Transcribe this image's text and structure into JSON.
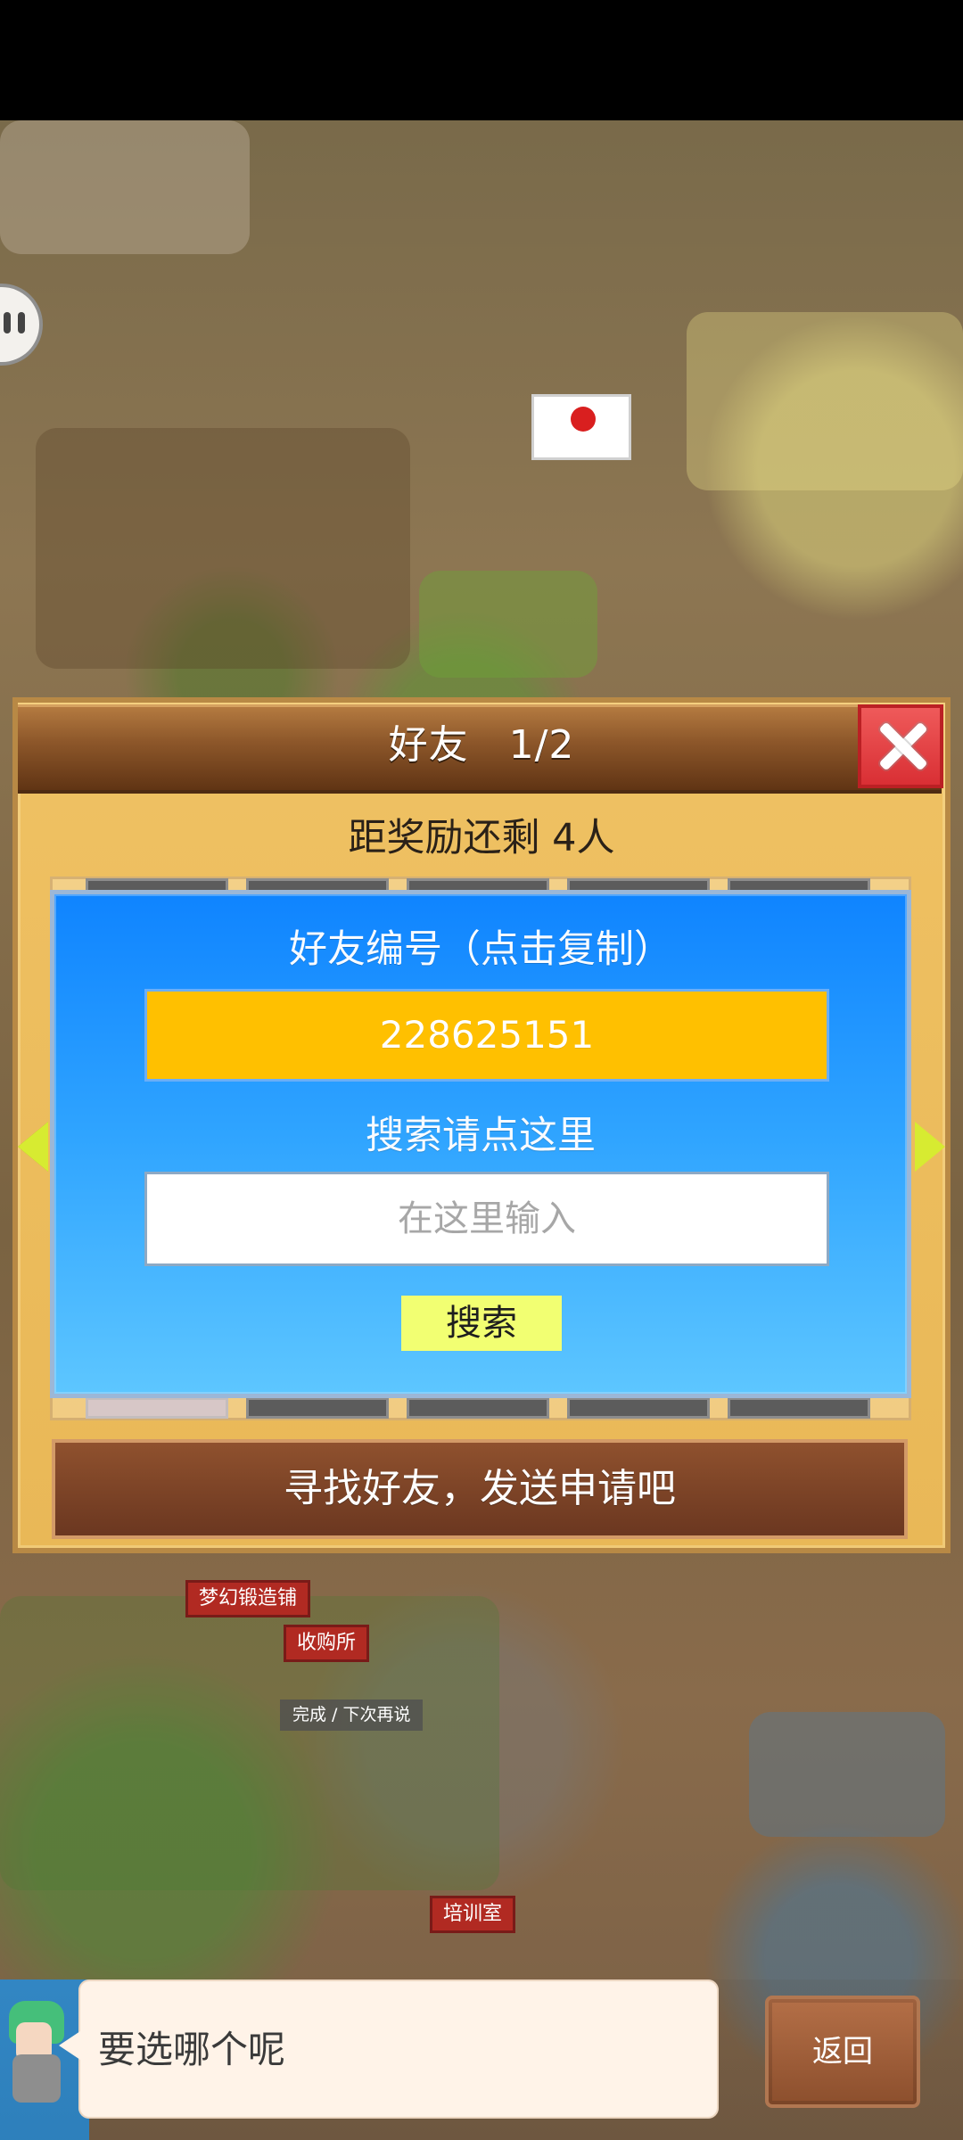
{
  "scene": {
    "top_labels": [
      {
        "text": "梦幻锻造铺"
      },
      {
        "text": "收购所"
      },
      {
        "text": "完成 / 下次再说"
      },
      {
        "text": "培训室"
      }
    ]
  },
  "modal": {
    "title": "好友　1/2",
    "reward_text": "距奖励还剩 4人",
    "friend_panel": {
      "friend_id_label": "好友编号（点击复制）",
      "friend_id_value": "228625151",
      "search_label": "搜索请点这里",
      "search_placeholder": "在这里输入",
      "search_button": "搜索"
    },
    "find_friends_button": "寻找好友，发送申请吧"
  },
  "bottom": {
    "speech_text": "要选哪个呢",
    "back_button": "返回"
  },
  "colors": {
    "modal_bg": "#efc163",
    "panel_blue": "#1a8cff",
    "id_yellow": "#ffc000",
    "button_yellow": "#f2ff72",
    "close_red": "#e13a3f",
    "brown_button": "#7d4528"
  },
  "icons": {
    "close": "close-icon",
    "left_nav": "chevron-left-icon",
    "right_nav": "chevron-right-icon",
    "side_helper": "chat-bubble-icon"
  }
}
